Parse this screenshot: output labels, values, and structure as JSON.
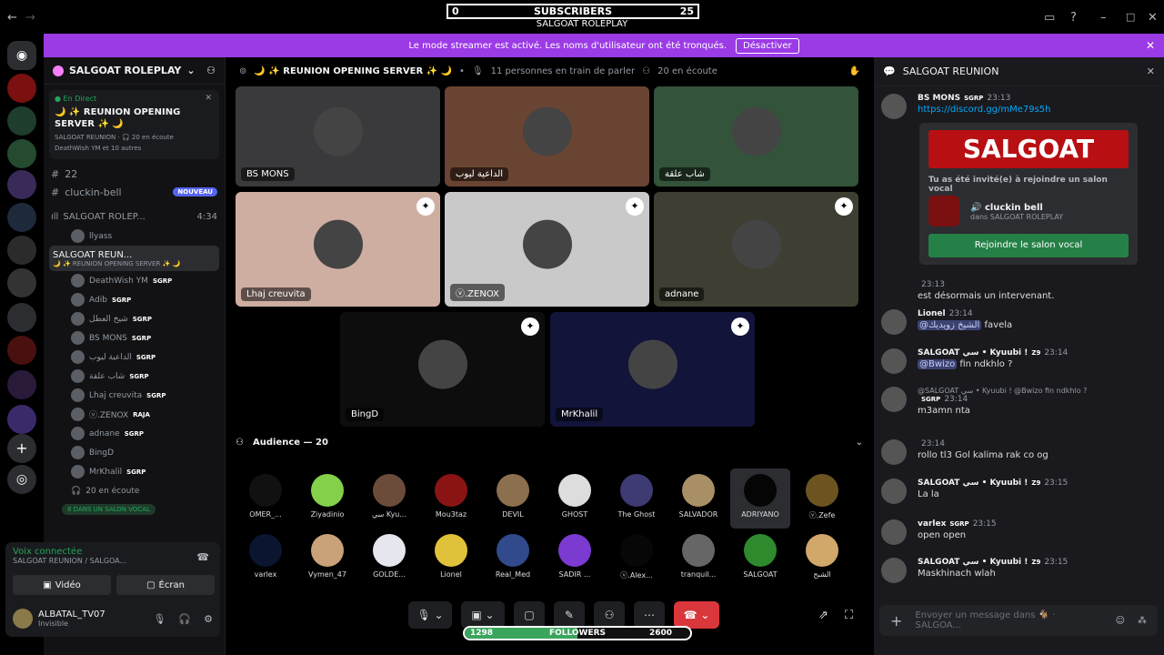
{
  "overlay": {
    "subscribers": {
      "label": "SUBSCRIBERS",
      "current": "0",
      "goal": "25"
    },
    "title": "SALGOAT ROLEPLAY",
    "followers": {
      "label": "FOLLOWERS",
      "current": "1298",
      "goal": "2600",
      "fraction": 0.5
    }
  },
  "window": {
    "back": "←",
    "forward": "→"
  },
  "streamer_banner": {
    "text": "Le mode streamer est activé. Les noms d'utilisateur ont été tronqués.",
    "button": "Désactiver"
  },
  "sidebar": {
    "server_name": "SALGOAT ROLEPLAY",
    "live": {
      "tag": "En Direct",
      "title": "🌙 ✨ REUNION OPENING SERVER ✨ 🌙",
      "meta": "SALGOAT REUNION · 🎧 20 en écoute",
      "viewers": "DeathWish YM et 10 autres"
    },
    "channels": [
      {
        "name": "22"
      },
      {
        "name": "cluckin-bell",
        "badge": "NOUVEAU"
      }
    ],
    "voice1": {
      "name": "SALGOAT ROLEP...",
      "time": "4:34",
      "member": "llyass"
    },
    "voice2": {
      "name": "SALGOAT REUN...",
      "sub": "🌙 ✨ REUNION OPENING SERVER ✨ 🌙"
    },
    "members": [
      {
        "name": "DeathWish YM",
        "tag": "SGRP"
      },
      {
        "name": "Adib",
        "tag": "SGRP"
      },
      {
        "name": "شيخ العطل",
        "tag": "SGRP"
      },
      {
        "name": "BS MONS",
        "tag": "SGRP"
      },
      {
        "name": "الداعية ليوب",
        "tag": "SGRP"
      },
      {
        "name": "شاب علقة",
        "tag": "SGRP"
      },
      {
        "name": "Lhaj creuvita",
        "tag": "SGRP"
      },
      {
        "name": "ⓥ.ZENOX",
        "tag": "RAJA"
      },
      {
        "name": "adnane",
        "tag": "SGRP"
      },
      {
        "name": "BingD",
        "tag": ""
      },
      {
        "name": "MrKhalil",
        "tag": "SGRP"
      }
    ],
    "listening": "20 en écoute",
    "in_voice": "8 DANS UN SALON VOCAL"
  },
  "voice_panel": {
    "status": "Voix connectée",
    "location": "SALGOAT REUNION / SALGOA...",
    "video": "Vidéo",
    "screen": "Écran"
  },
  "user": {
    "name": "ALBATAL_TV07",
    "status": "Invisible"
  },
  "stage": {
    "title": "🌙 ✨ REUNION OPENING SERVER ✨ 🌙",
    "speakers": "11 personnes en train de parler",
    "listeners": "20 en écoute",
    "tiles": [
      {
        "name": "BS MONS",
        "bg": "#3a3a3c"
      },
      {
        "name": "الداعية ليوب",
        "bg": "#6a4432"
      },
      {
        "name": "شاب علقة",
        "bg": "#33533a"
      },
      {
        "name": "Lhaj creuvita",
        "bg": "#cfaea2"
      },
      {
        "name": "ⓥ.ZENOX",
        "bg": "#c9c9c9"
      },
      {
        "name": "adnane",
        "bg": "#3e3e32"
      },
      {
        "name": "BingD",
        "bg": "#0d0d0d"
      },
      {
        "name": "MrKhalil",
        "bg": "#12143a"
      }
    ],
    "audience_title": "Audience — 20",
    "audience": [
      {
        "name": "OMER_...",
        "c": "#111"
      },
      {
        "name": "Ziyadinio",
        "c": "#84d04a"
      },
      {
        "name": "سي Kyu...",
        "c": "#6b4b3a"
      },
      {
        "name": "Mou3taz",
        "c": "#8a1414"
      },
      {
        "name": "DEVIL",
        "c": "#8b6f4e"
      },
      {
        "name": "GHOST",
        "c": "#ddd"
      },
      {
        "name": "The Ghost",
        "c": "#3e3a72"
      },
      {
        "name": "SALVADOR",
        "c": "#a88f66"
      },
      {
        "name": "ADRIYANO",
        "c": "#050505"
      },
      {
        "name": "ⓥ.Zefe",
        "c": "#6b5420"
      },
      {
        "name": "varlex",
        "c": "#0b1530"
      },
      {
        "name": "Vymen_47",
        "c": "#c9a27a"
      },
      {
        "name": "GOLDE...",
        "c": "#e6e6ee"
      },
      {
        "name": "Lionel",
        "c": "#e0c23a"
      },
      {
        "name": "Real_Med",
        "c": "#304a8c"
      },
      {
        "name": "SADIR ...",
        "c": "#7b3ad0"
      },
      {
        "name": "ⓥ.Alex...",
        "c": "#070707"
      },
      {
        "name": "tranquil...",
        "c": "#666"
      },
      {
        "name": "SALGOAT",
        "c": "#2d8a2d"
      },
      {
        "name": "الشبح",
        "c": "#d2a76a"
      }
    ]
  },
  "chat": {
    "header": "SALGOAT REUNION",
    "messages": [
      {
        "author": "BS MONS",
        "tag": "SGRP",
        "time": "23:13",
        "body": "https://discord.gg/mMe79s5h"
      },
      {
        "author": "",
        "tag": "",
        "time": "23:13",
        "body": "est désormais un intervenant."
      },
      {
        "author": "Lionel",
        "tag": "",
        "time": "23:14",
        "body": "favela",
        "mention": "@الشيخ زويديك"
      },
      {
        "author": "SALGOAT سي • Kyuubi !",
        "tag": "Z9",
        "time": "23:14",
        "body": "fin ndkhlo ?",
        "mention": "@Bwizo"
      },
      {
        "author": "",
        "tag": "SGRP",
        "time": "23:14",
        "body": "m3amn nta",
        "reply": "@SALGOAT سي • Kyuubi ! @Bwizo fin ndkhlo ?"
      },
      {
        "author": "",
        "tag": "",
        "time": "23:14",
        "body": "rollo tl3 Gol kalima rak co og"
      },
      {
        "author": "SALGOAT سي • Kyuubi !",
        "tag": "Z9",
        "time": "23:15",
        "body": "La la"
      },
      {
        "author": "varlex",
        "tag": "SGRP",
        "time": "23:15",
        "body": "open open"
      },
      {
        "author": "SALGOAT سي • Kyuubi !",
        "tag": "Z9",
        "time": "23:15",
        "body": "Maskhinach wlah"
      }
    ],
    "invite": {
      "banner": "SALGOAT",
      "title": "Tu as été invité(e) à rejoindre un salon vocal",
      "channel": "cluckin bell",
      "server": "dans SALGOAT ROLEPLAY",
      "join": "Rejoindre le salon vocal"
    },
    "placeholder": "Envoyer un message dans 🐐 · SALGOA..."
  }
}
